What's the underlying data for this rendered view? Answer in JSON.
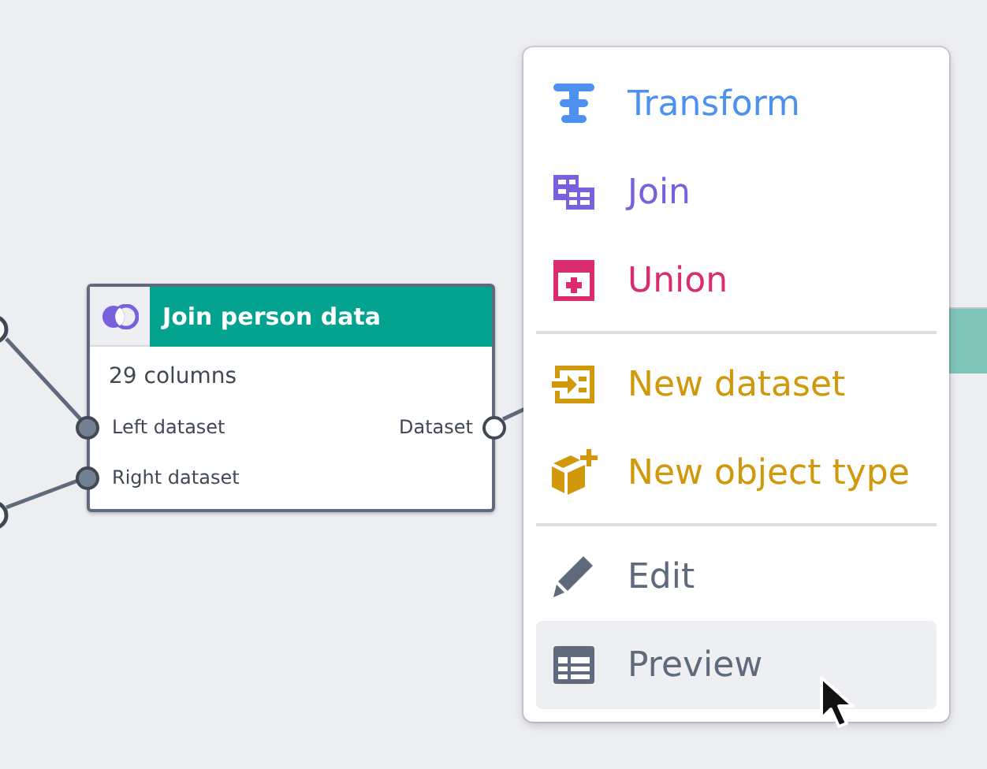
{
  "node": {
    "title": "Join person data",
    "summary": "29 columns",
    "inputs": [
      {
        "label": "Left dataset"
      },
      {
        "label": "Right dataset"
      }
    ],
    "outputs": [
      {
        "label": "Dataset"
      }
    ]
  },
  "menu": {
    "sections": [
      [
        {
          "kind": "transform",
          "label": "Transform",
          "color": "#4c90f0",
          "hovered": false
        },
        {
          "kind": "join",
          "label": "Join",
          "color": "#7961db",
          "hovered": false
        },
        {
          "kind": "union",
          "label": "Union",
          "color": "#db2c6f",
          "hovered": false
        }
      ],
      [
        {
          "kind": "dataset",
          "label": "New dataset",
          "color": "#d1980b",
          "hovered": false
        },
        {
          "kind": "object",
          "label": "New object type",
          "color": "#d1980b",
          "hovered": false
        }
      ],
      [
        {
          "kind": "edit",
          "label": "Edit",
          "color": "#5f6b7c",
          "hovered": false
        },
        {
          "kind": "preview",
          "label": "Preview",
          "color": "#5f6b7c",
          "hovered": true
        }
      ]
    ]
  }
}
